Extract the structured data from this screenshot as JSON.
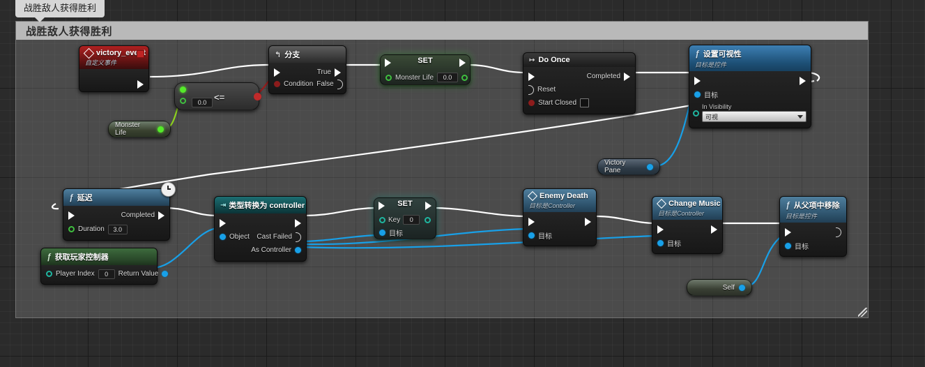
{
  "app": {
    "tooltip_label": "战胜敌人获得胜利"
  },
  "comment": {
    "title": "战胜敌人获得胜利"
  },
  "nodes": {
    "victory_event": {
      "title": "victory_event",
      "subtitle": "自定义事件"
    },
    "branch": {
      "title": "分支",
      "exec_in": "",
      "condition_label": "Condition",
      "true_label": "True",
      "false_label": "False"
    },
    "compare": {
      "operator": "<=",
      "value": "0.0"
    },
    "monster_life_get": {
      "label": "Monster Life"
    },
    "set_monster_life": {
      "title": "SET",
      "var_label": "Monster Life",
      "value": "0.0"
    },
    "do_once": {
      "title": "Do Once",
      "completed_label": "Completed",
      "reset_label": "Reset",
      "start_closed_label": "Start Closed",
      "start_closed_checked": false
    },
    "set_visibility": {
      "title": "设置可视性",
      "subtitle": "目标是控件",
      "target_label": "目标",
      "in_visibility_label": "In Visibility",
      "visibility_value": "可视"
    },
    "victory_pane_get": {
      "label": "Victory Pane"
    },
    "delay": {
      "title": "延迟",
      "completed_label": "Completed",
      "duration_label": "Duration",
      "duration_value": "3.0",
      "badge": "clock-icon"
    },
    "get_player_controller": {
      "title": "获取玩家控制器",
      "player_index_label": "Player Index",
      "player_index_value": "0",
      "return_value_label": "Return Value"
    },
    "cast_to_controller": {
      "title": "类型转换为 controller",
      "object_label": "Object",
      "cast_failed_label": "Cast Failed",
      "as_controller_label": "As Controller"
    },
    "set_key": {
      "title": "SET",
      "key_label": "Key",
      "key_value": "0",
      "target_label": "目标"
    },
    "enemy_death": {
      "title": "Enemy Death",
      "subtitle": "目标是Controller",
      "target_label": "目标"
    },
    "change_music": {
      "title": "Change Music",
      "subtitle": "目标是Controller",
      "target_label": "目标"
    },
    "remove_from_parent": {
      "title": "从父项中移除",
      "subtitle": "目标是控件",
      "target_label": "目标"
    },
    "self_get": {
      "label": "Self"
    }
  },
  "colors": {
    "exec_wire": "#ffffff",
    "object_wire": "#18a0e8",
    "bool_wire": "#9c1c1c",
    "float_wire": "#8fd41f",
    "comment_bar": "#b9b9b9",
    "canvas": "#2b2b2b"
  }
}
